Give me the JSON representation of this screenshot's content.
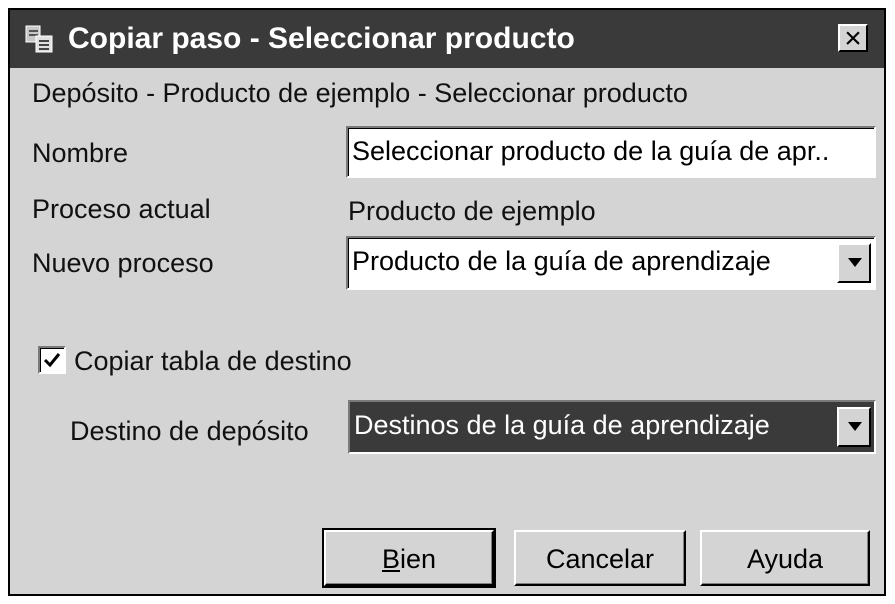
{
  "window": {
    "title": "Copiar paso - Seleccionar producto"
  },
  "breadcrumb": "Depósito - Producto de ejemplo - Seleccionar producto",
  "form": {
    "name_label": "Nombre",
    "name_value": "Seleccionar producto de la guía de apr..",
    "current_process_label": "Proceso actual",
    "current_process_value": "Producto de ejemplo",
    "new_process_label": "Nuevo proceso",
    "new_process_value": "Producto de la guía de aprendizaje",
    "copy_target_checkbox_label": "Copiar tabla de destino",
    "copy_target_checked": true,
    "warehouse_target_label": "Destino de depósito",
    "warehouse_target_value": "Destinos de la guía de aprendizaje"
  },
  "buttons": {
    "ok_mnemonic": "B",
    "ok_rest": "ien",
    "cancel": "Cancelar",
    "help": "Ayuda"
  },
  "icons": {
    "title": "copy-step-icon",
    "close": "close-icon",
    "dropdown": "chevron-down-icon",
    "check": "checkmark-icon"
  }
}
